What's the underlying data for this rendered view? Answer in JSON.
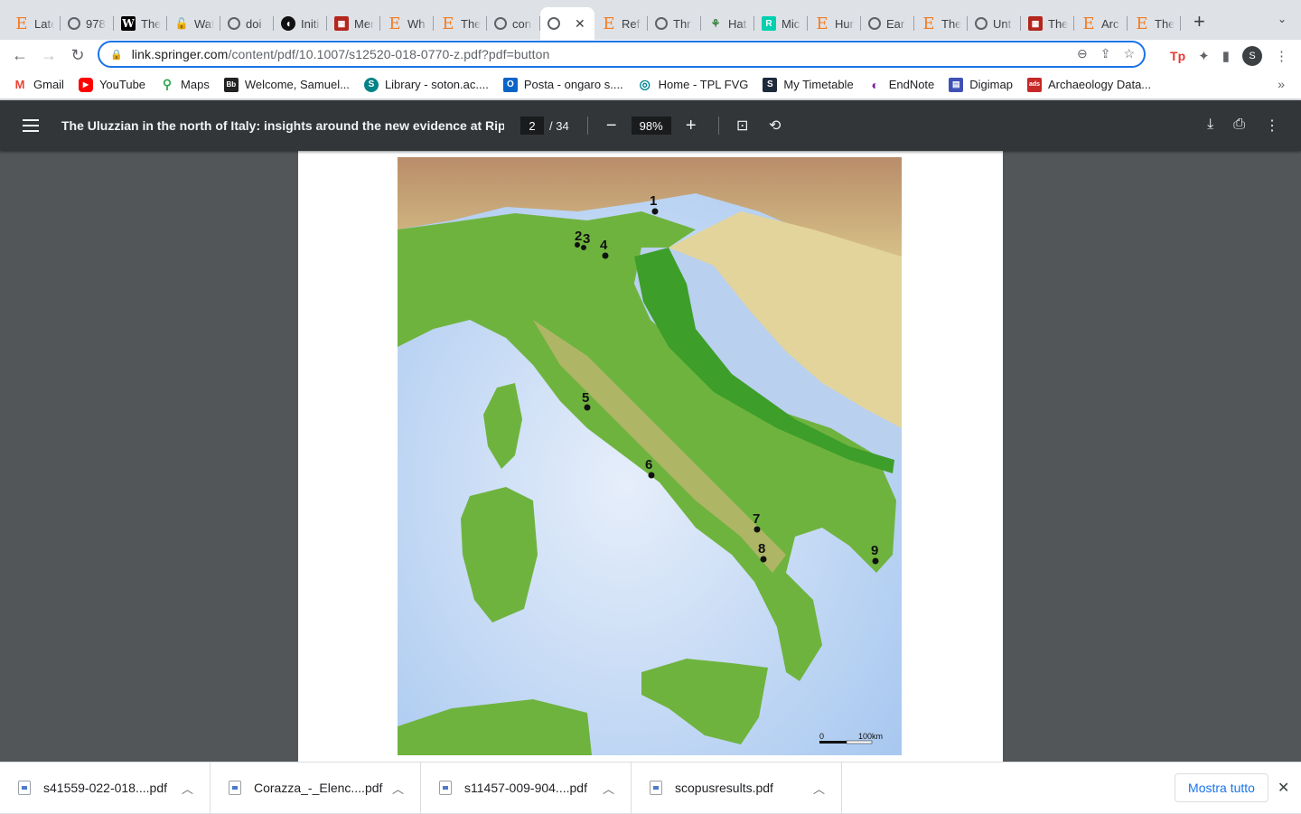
{
  "tabs": [
    {
      "title": "Late",
      "icon": "elsevier-icon"
    },
    {
      "title": "978",
      "icon": "globe-icon"
    },
    {
      "title": "The",
      "icon": "wiley-icon"
    },
    {
      "title": "Wat",
      "icon": "unlock-icon"
    },
    {
      "title": "doi",
      "icon": "globe-icon"
    },
    {
      "title": "Initi",
      "icon": "circle-logo-icon"
    },
    {
      "title": "Mer",
      "icon": "library-icon"
    },
    {
      "title": "Wh",
      "icon": "elsevier-icon"
    },
    {
      "title": "The",
      "icon": "elsevier-icon"
    },
    {
      "title": "con",
      "icon": "globe-icon"
    },
    {
      "title": "",
      "icon": "globe-icon",
      "active": true
    },
    {
      "title": "Ref",
      "icon": "elsevier-icon"
    },
    {
      "title": "Thr",
      "icon": "globe-icon"
    },
    {
      "title": "Hat",
      "icon": "hathi-icon"
    },
    {
      "title": "Mic",
      "icon": "researchgate-icon"
    },
    {
      "title": "Hur",
      "icon": "elsevier-icon"
    },
    {
      "title": "Ear",
      "icon": "globe-icon"
    },
    {
      "title": "The",
      "icon": "elsevier-icon"
    },
    {
      "title": "Unt",
      "icon": "globe-icon"
    },
    {
      "title": "The",
      "icon": "library-icon"
    },
    {
      "title": "Arc",
      "icon": "elsevier-icon"
    },
    {
      "title": "The",
      "icon": "elsevier-icon"
    }
  ],
  "address_bar": {
    "host": "link.springer.com",
    "path": "/content/pdf/10.1007/s12520-018-0770-z.pdf?pdf=button"
  },
  "profile_initial": "S",
  "bookmarks": [
    {
      "label": "Gmail",
      "icon": "gmail-icon"
    },
    {
      "label": "YouTube",
      "icon": "youtube-icon"
    },
    {
      "label": "Maps",
      "icon": "maps-icon"
    },
    {
      "label": "Welcome, Samuel...",
      "icon": "blackboard-icon"
    },
    {
      "label": "Library - soton.ac....",
      "icon": "sharepoint-icon"
    },
    {
      "label": "Posta - ongaro s....",
      "icon": "outlook-icon"
    },
    {
      "label": "Home - TPL FVG",
      "icon": "tpl-icon"
    },
    {
      "label": "My Timetable",
      "icon": "timetable-icon"
    },
    {
      "label": "EndNote",
      "icon": "endnote-icon"
    },
    {
      "label": "Digimap",
      "icon": "digimap-icon"
    },
    {
      "label": "Archaeology Data...",
      "icon": "ads-icon"
    }
  ],
  "pdf": {
    "title": "The Uluzzian in the north of Italy: insights around the new evidence at Riparo...",
    "page_current": "2",
    "page_total": "/ 34",
    "zoom": "98%"
  },
  "map": {
    "sites": [
      {
        "label": "1"
      },
      {
        "label": "2"
      },
      {
        "label": "3"
      },
      {
        "label": "4"
      },
      {
        "label": "5"
      },
      {
        "label": "6"
      },
      {
        "label": "7"
      },
      {
        "label": "8"
      },
      {
        "label": "9"
      }
    ],
    "scale_start": "0",
    "scale_end": "100km"
  },
  "downloads": [
    {
      "name": "s41559-022-018....pdf"
    },
    {
      "name": "Corazza_-_Elenc....pdf"
    },
    {
      "name": "s11457-009-904....pdf"
    },
    {
      "name": "scopusresults.pdf"
    }
  ],
  "show_all_label": "Mostra tutto"
}
